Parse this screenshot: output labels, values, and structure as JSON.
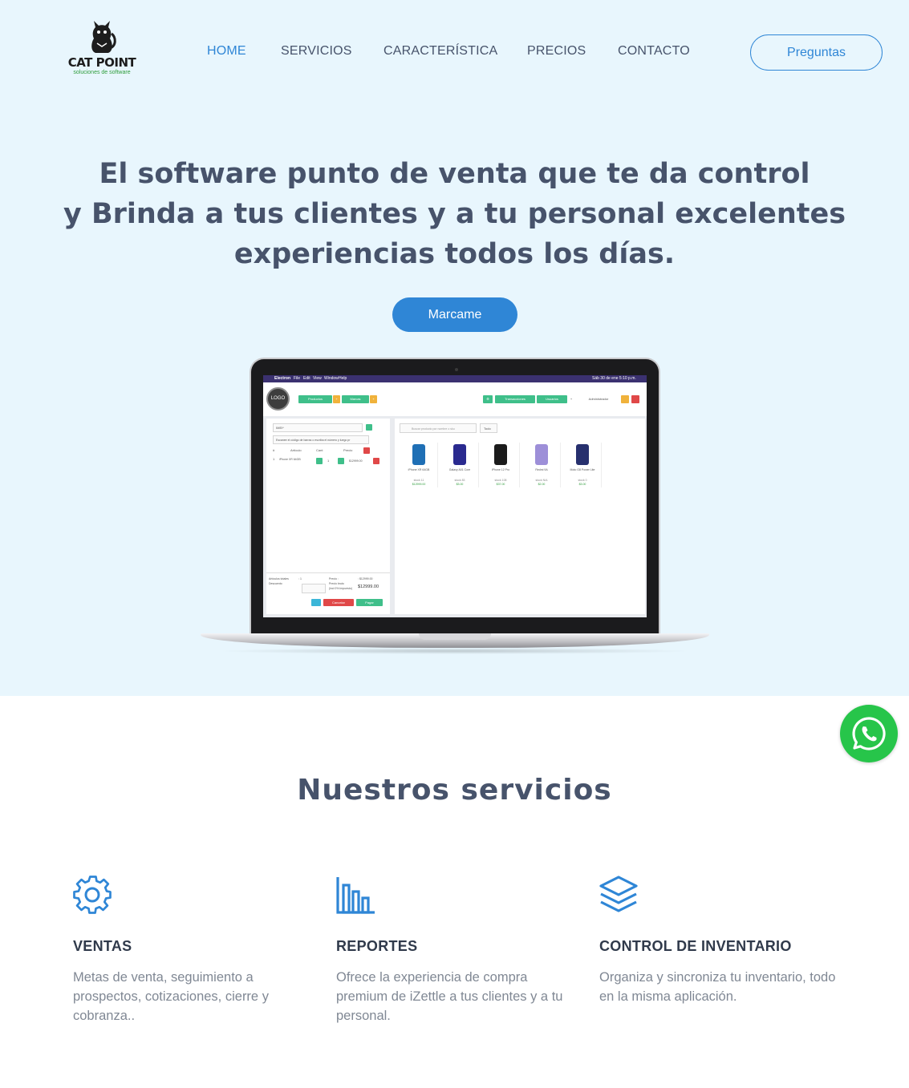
{
  "brand": {
    "name": "CAT POINT",
    "tagline": "soluciones de software"
  },
  "nav": {
    "items": [
      {
        "label": "HOME",
        "active": true
      },
      {
        "label": "SERVICIOS"
      },
      {
        "label": "CARACTERÍSTICA"
      },
      {
        "label": "PRECIOS"
      },
      {
        "label": "CONTACTO"
      }
    ],
    "cta_label": "Preguntas"
  },
  "hero": {
    "title_lines": [
      "El software punto de venta que te da control",
      "y Brinda a tus clientes y a tu personal excelentes",
      "experiencias todos los días."
    ],
    "button_label": "Marcame"
  },
  "mockup": {
    "menubar_app": "Electron",
    "menubar_items": [
      "File",
      "Edit",
      "View",
      "Window",
      "Help"
    ],
    "menubar_clock": "Sáb 30 de ene 5:10 p.m.",
    "logo_text": "LOGO",
    "toolbar": [
      "Productos",
      "Marcas",
      "Transacciones",
      "Usuarios",
      "Administrador"
    ],
    "search_placeholder": "Buscar producto por nombre o sku",
    "filter_label": "Todo",
    "client_select": "IMEI*",
    "barcode_placeholder": "Escanee el código de barras o escriba el número y luego pr",
    "cart_headers": [
      "#",
      "Artículo",
      "Cant",
      "Precio"
    ],
    "cart_row": {
      "num": "1",
      "item": "iPhone XR 64GB",
      "qty": "1",
      "price": "$12999.00"
    },
    "totals": {
      "items_label": "Artículos totales",
      "items_value": ": 1",
      "discount_label": "Descuento",
      "price_label": "Precio :",
      "price_value": ": $12999.00",
      "gross_label": "Precio bruto",
      "tax_label": "(incl 0% Impuesto)",
      "grand_total": "$12999.00",
      "cancel_label": "Cancelar",
      "pay_label": "Pagar"
    },
    "products": [
      {
        "name": "iPhone XR 64GB",
        "stock": "stock 11",
        "price": "$12999.00",
        "color": "#1f6fb5"
      },
      {
        "name": "Galaxy A01 Core",
        "stock": "stock 83",
        "price": "$3.00",
        "color": "#2a2a8f"
      },
      {
        "name": "iPhone 12 Pro",
        "stock": "stock 108",
        "price": "$37.00",
        "color": "#1b1b1b"
      },
      {
        "name": "Redmi 9A",
        "stock": "stock N/A",
        "price": "$2.00",
        "color": "#9d8fd8"
      },
      {
        "name": "Moto G8 Power Lite",
        "stock": "stock 0",
        "price": "$3.00",
        "color": "#27306e"
      }
    ]
  },
  "services": {
    "title": "Nuestros servicios",
    "items": [
      {
        "icon": "gear-icon",
        "title": "VENTAS",
        "text": "Metas de venta, seguimiento a prospectos, cotizaciones, cierre y cobranza.."
      },
      {
        "icon": "bar-chart-icon",
        "title": "REPORTES",
        "text": "Ofrece la experiencia de compra premium de iZettle a tus clientes y a tu personal."
      },
      {
        "icon": "layers-icon",
        "title": "CONTROL DE INVENTARIO",
        "text": "Organiza y sincroniza tu inventario, todo en la misma aplicación."
      }
    ]
  },
  "colors": {
    "accent": "#2f86d6",
    "hero_bg": "#e8f6fd",
    "heading": "#47536b",
    "whatsapp": "#27c54a"
  }
}
